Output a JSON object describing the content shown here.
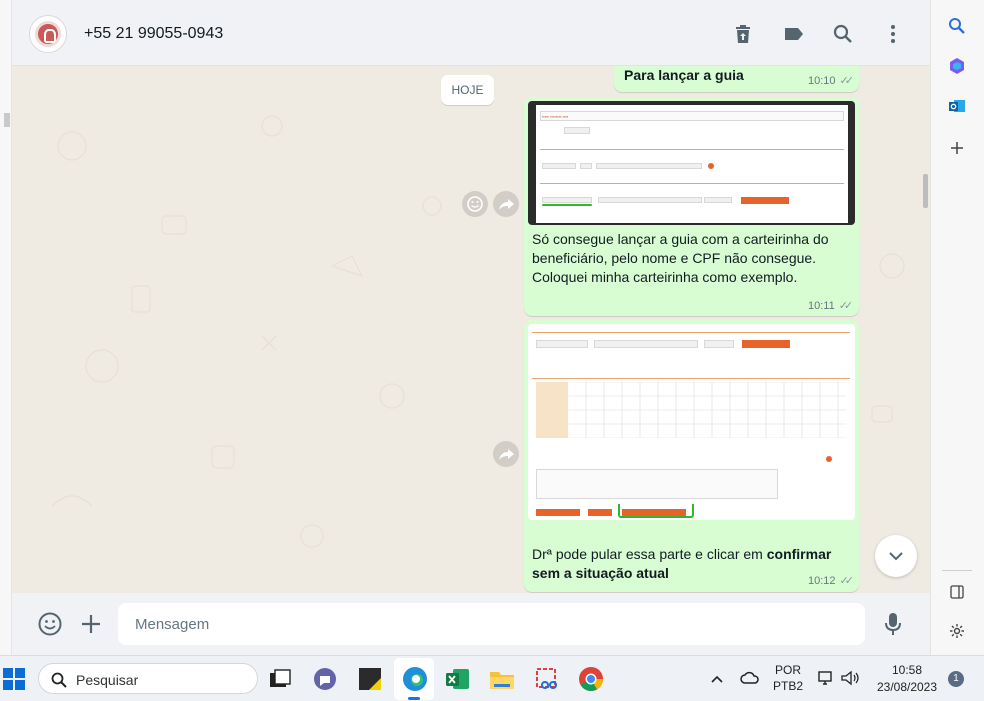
{
  "header": {
    "contact_name": "+55 21 99055-0943",
    "icons": [
      "avatar",
      "archive-icon",
      "label-icon",
      "search-icon",
      "more-vertical-icon"
    ]
  },
  "chat": {
    "day_chip": "HOJE",
    "messages": [
      {
        "text": "Para lançar a guia",
        "time": "10:10"
      },
      {
        "text": "Só consegue lançar a guia com a carteirinha do beneficiário, pelo nome e CPF não consegue. Coloquei minha carteirinha como exemplo.",
        "time": "10:11"
      },
      {
        "text_normal": "Drª pode pular essa parte e clicar em ",
        "text_bold": "confirmar sem a situação atual",
        "time": "10:12"
      }
    ]
  },
  "composer": {
    "placeholder": "Mensagem"
  },
  "taskbar": {
    "search_placeholder": "Pesquisar",
    "lang_line1": "POR",
    "lang_line2": "PTB2",
    "clock_time": "10:58",
    "clock_date": "23/08/2023",
    "notification_count": "1"
  },
  "colors": {
    "bubble_out": "#d9fdd3",
    "chat_bg": "#efeae2",
    "header_bg": "#f0f2f5",
    "accent_orange": "#e8632a",
    "highlight_green": "#2eb82e"
  }
}
